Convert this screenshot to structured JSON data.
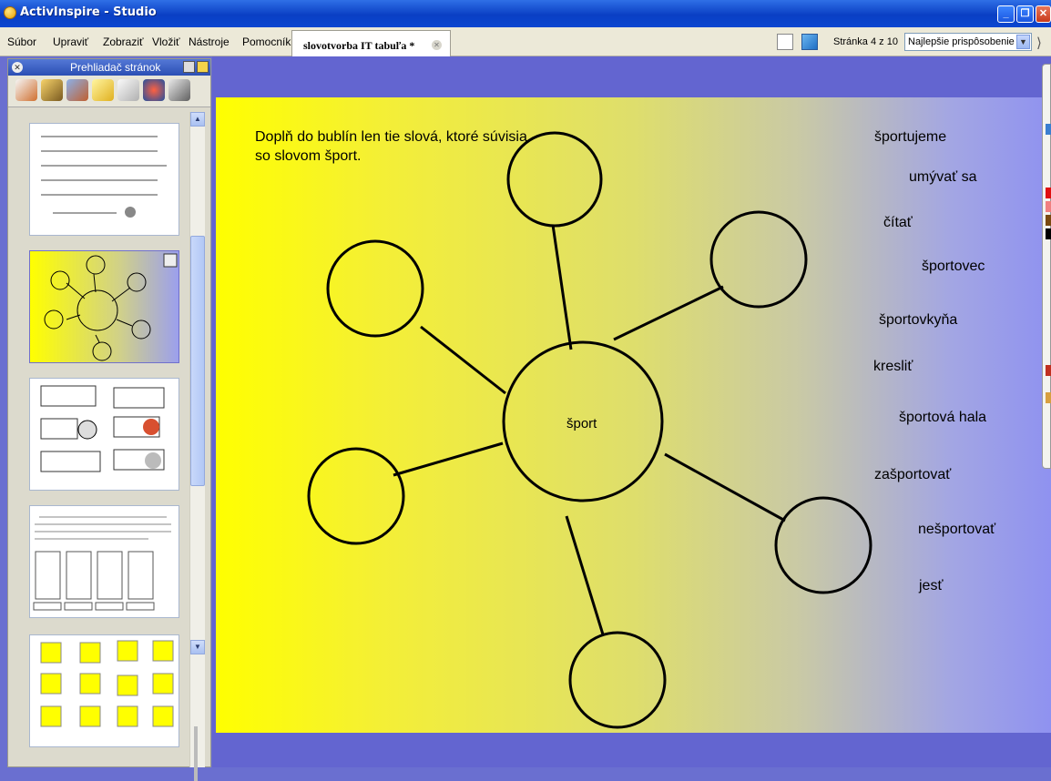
{
  "window": {
    "title": "ActivInspire - Studio"
  },
  "menu": [
    "Súbor",
    "Upraviť",
    "Zobraziť",
    "Vložiť",
    "Nástroje",
    "Pomocník"
  ],
  "document_tab": "slovotvorba IT tabuľa *",
  "page_indicator": "Stránka 4 z 10",
  "zoom": "Najlepšie prispôsobenie",
  "sidebar": {
    "title": "Prehliadač stránok"
  },
  "slide": {
    "instructions": "Doplň do bublín len tie slová, ktoré súvisia so slovom šport.",
    "center_word": "šport",
    "words": [
      "športujeme",
      "umývať sa",
      "čítať",
      "športovec",
      "športovkyňa",
      "kresliť",
      "športová hala",
      "zašportovať",
      "nešportovať",
      "jesť"
    ]
  },
  "colors": {
    "accent": "#6365d0",
    "page_left": "#ffff00",
    "page_right": "#8f92f0"
  }
}
